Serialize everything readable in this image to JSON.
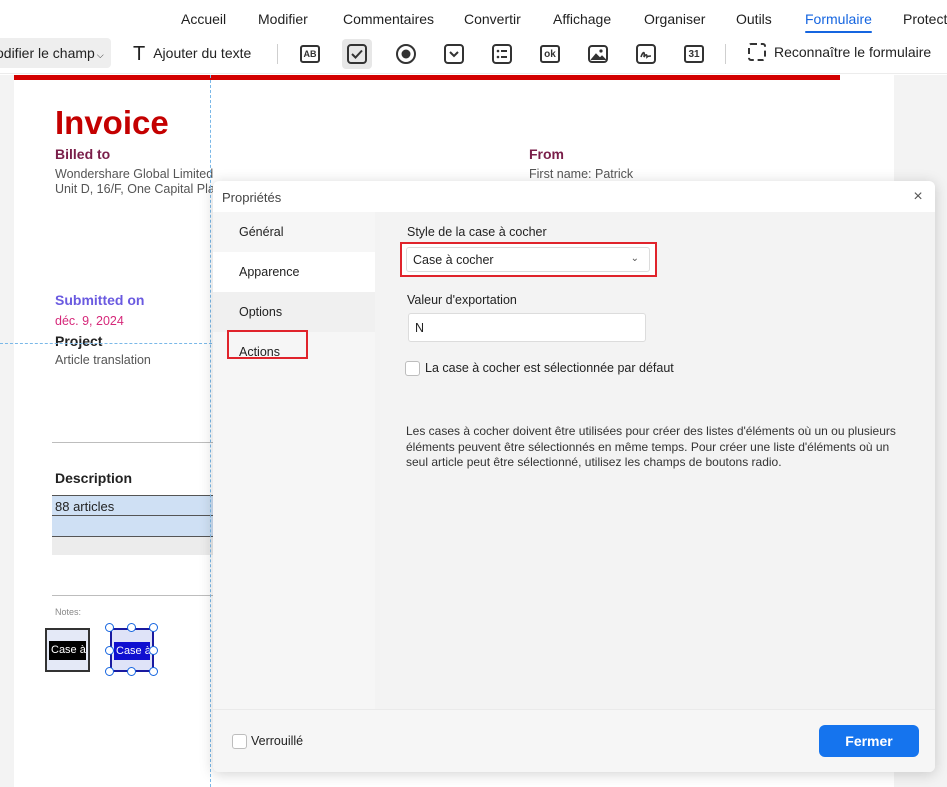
{
  "menu": {
    "tabs": [
      {
        "label": "Accueil"
      },
      {
        "label": "Modifier"
      },
      {
        "label": "Commentaires"
      },
      {
        "label": "Convertir"
      },
      {
        "label": "Affichage"
      },
      {
        "label": "Organiser"
      },
      {
        "label": "Outils"
      },
      {
        "label": "Formulaire"
      },
      {
        "label": "Protect"
      }
    ],
    "active": "Formulaire"
  },
  "toolbar": {
    "modify_field_label": "odifier le champ",
    "add_text_label": "Ajouter du texte",
    "text_icon_glyph": "T",
    "icons": [
      "text-field-icon",
      "checkbox-icon",
      "radio-button-icon",
      "dropdown-icon",
      "list-box-icon",
      "button-icon",
      "image-field-icon",
      "signature-field-icon",
      "date-field-icon"
    ],
    "icon_glyphs": {
      "text_field": "AB",
      "button": "ok",
      "date": "31"
    },
    "recognize_label": "Reconnaître le formulaire"
  },
  "document": {
    "title": "Invoice",
    "billed_to": "Billed to",
    "billed_line1": "Wondershare Global Limited",
    "billed_line2": "Unit D, 16/F, One Capital Pla",
    "from": "From",
    "from_name": "First name: Patrick",
    "submitted_on": "Submitted on",
    "submitted_date": "déc. 9, 2024",
    "project": "Project",
    "project_value": "Article translation",
    "description": "Description",
    "row1": "88 articles",
    "notes": "Notes:",
    "checkbox1_label": "Case à",
    "checkbox2_label": "Case à"
  },
  "dialog": {
    "title": "Propriétés",
    "close_glyph": "×",
    "sidebar": [
      {
        "label": "Général"
      },
      {
        "label": "Apparence"
      },
      {
        "label": "Options"
      },
      {
        "label": "Actions"
      }
    ],
    "selected_tab": "Options",
    "style_label": "Style de la case à cocher",
    "style_value": "Case à cocher",
    "style_chevron": "⌄",
    "export_label": "Valeur d'exportation",
    "export_value": "N",
    "default_checked_label": "La case à cocher est sélectionnée par défaut",
    "default_checked": false,
    "help_text": "Les cases à cocher doivent être utilisées pour créer des listes d'éléments où un ou plusieurs éléments peuvent être sélectionnés en même temps. Pour créer une liste d'éléments où un seul article peut être sélectionné, utilisez les champs de boutons radio.",
    "locked_label": "Verrouillé",
    "locked": false,
    "close_button": "Fermer"
  },
  "colors": {
    "accent": "#1565e0",
    "primary_button": "#1574ee",
    "highlight_red": "#e0232b",
    "invoice_red": "#c40000"
  }
}
